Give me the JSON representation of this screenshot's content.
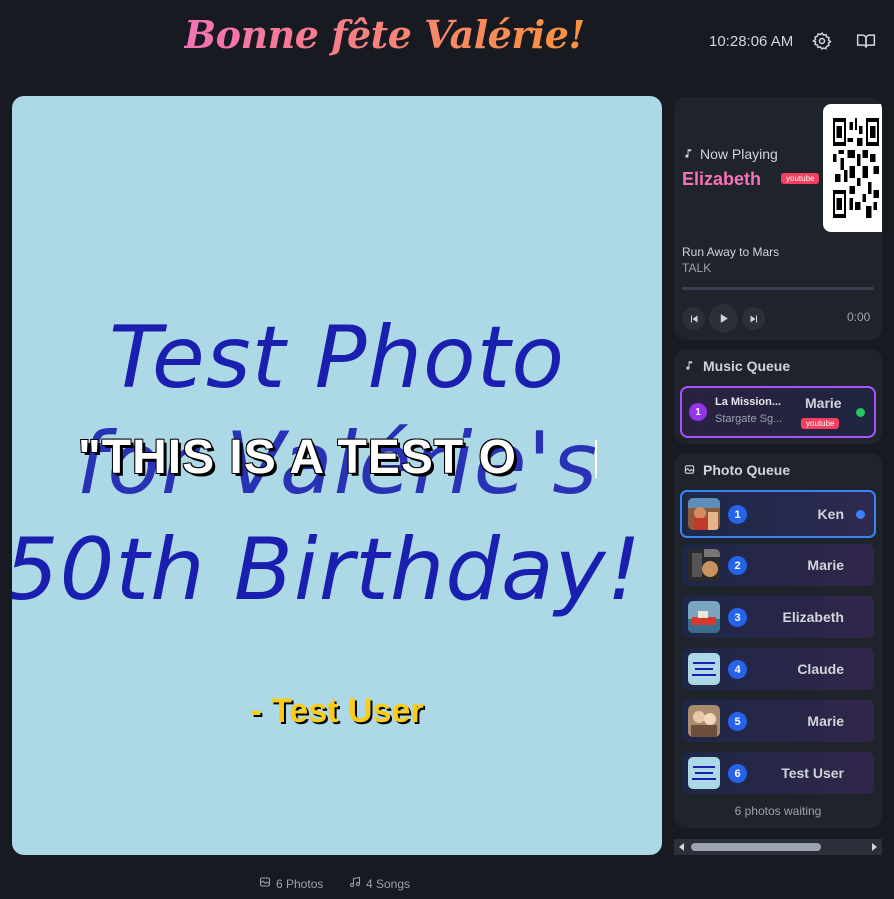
{
  "header": {
    "title": "Bonne fête Valérie!",
    "clock": "10:28:06 AM",
    "settings_icon": "gear-icon",
    "guide_icon": "book-icon"
  },
  "display": {
    "photo_text_lines": [
      "Test Photo",
      "for Valérie's",
      "50th Birthday!"
    ],
    "caption": "\"THIS IS A TEST O",
    "author": "- Test User"
  },
  "footer": {
    "photos": "6 Photos",
    "songs": "4 Songs"
  },
  "now_playing": {
    "heading": "Now Playing",
    "singer": "Elizabeth",
    "source": "youtube",
    "song": "Run Away to Mars",
    "artist": "TALK",
    "time": "0:00",
    "progress": 0
  },
  "music_queue": {
    "heading": "Music Queue",
    "items": [
      {
        "num": "1",
        "song": "La Mission...",
        "artist": "Stargate Sg...",
        "singer": "Marie",
        "source": "youtube"
      }
    ]
  },
  "photo_queue": {
    "heading": "Photo Queue",
    "items": [
      {
        "num": "1",
        "name": "Ken",
        "thumb": "beach"
      },
      {
        "num": "2",
        "name": "Marie",
        "thumb": "dark"
      },
      {
        "num": "3",
        "name": "Elizabeth",
        "thumb": "boat"
      },
      {
        "num": "4",
        "name": "Claude",
        "thumb": "text"
      },
      {
        "num": "5",
        "name": "Marie",
        "thumb": "people"
      },
      {
        "num": "6",
        "name": "Test User",
        "thumb": "text"
      }
    ],
    "waiting": "6 photos waiting"
  },
  "colors": {
    "accent_pink": "#f472b6",
    "accent_blue": "#3b82f6",
    "accent_purple": "#a855f7",
    "caption_yellow": "#facc15"
  }
}
